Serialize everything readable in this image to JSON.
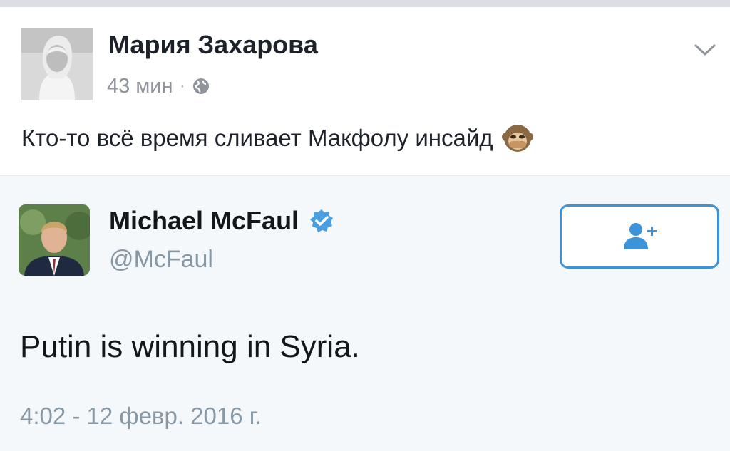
{
  "post": {
    "author_name": "Мария Захарова",
    "time": "43 мин",
    "separator": "·",
    "text": "Кто-то всё время сливает Макфолу инсайд",
    "icons": {
      "avatar": "profile-photo",
      "privacy": "globe-icon",
      "menu": "chevron-down-icon",
      "emoji": "see-no-evil-monkey-icon"
    }
  },
  "tweet": {
    "author_name": "Michael McFaul",
    "handle": "@McFaul",
    "text": "Putin is winning in Syria.",
    "timestamp": "4:02 - 12 февр. 2016 г.",
    "icons": {
      "verified": "verified-badge-icon",
      "follow": "follow-user-icon"
    }
  },
  "colors": {
    "text": "#1d2129",
    "meta": "#90949c",
    "twitter_blue": "#3b94d9",
    "tweet_gray": "#8899a6",
    "tweet_bg": "#f5f8fa"
  }
}
